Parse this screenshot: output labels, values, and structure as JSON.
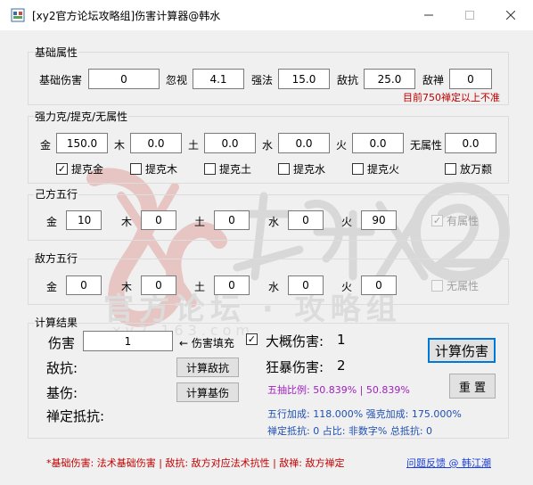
{
  "window": {
    "title": "[xy2官方论坛攻略组]伤害计算器@韩水",
    "icons": [
      "app-icon",
      "minimize-icon",
      "maximize-icon",
      "close-icon"
    ]
  },
  "base": {
    "group_title": "基础属性",
    "base_damage_label": "基础伤害",
    "base_damage": "0",
    "ignore_label": "忽视",
    "ignore": "4.1",
    "strength_label": "强法",
    "strength": "15.0",
    "enemy_resist_label": "敌抗",
    "enemy_resist": "25.0",
    "enemy_zen_label": "敌禅",
    "enemy_zen": "0",
    "note": "目前750禅定以上不准"
  },
  "strong": {
    "group_title": "强力克/提克/无属性",
    "items": [
      {
        "label": "金",
        "value": "150.0",
        "check_label": "提克金",
        "checked": true
      },
      {
        "label": "木",
        "value": "0.0",
        "check_label": "提克木",
        "checked": false
      },
      {
        "label": "土",
        "value": "0.0",
        "check_label": "提克土",
        "checked": false
      },
      {
        "label": "水",
        "value": "0.0",
        "check_label": "提克水",
        "checked": false
      },
      {
        "label": "火",
        "value": "0.0",
        "check_label": "提克火",
        "checked": false
      },
      {
        "label": "无属性",
        "value": "0.0",
        "check_label": "放万颣",
        "checked": false
      }
    ]
  },
  "own": {
    "group_title": "己方五行",
    "items": [
      {
        "label": "金",
        "value": "10"
      },
      {
        "label": "木",
        "value": "0"
      },
      {
        "label": "土",
        "value": "0"
      },
      {
        "label": "水",
        "value": "0"
      },
      {
        "label": "火",
        "value": "90"
      }
    ],
    "attr_label": "有属性",
    "attr_checked": true
  },
  "enemy": {
    "group_title": "敌方五行",
    "items": [
      {
        "label": "金",
        "value": "0"
      },
      {
        "label": "木",
        "value": "0"
      },
      {
        "label": "土",
        "value": "0"
      },
      {
        "label": "水",
        "value": "0"
      },
      {
        "label": "火",
        "value": "0"
      }
    ],
    "attr_label": "无属性",
    "attr_checked": false
  },
  "result": {
    "group_title": "计算结果",
    "damage_label": "伤害",
    "damage_value": "1",
    "fill_hint": "← 伤害填充",
    "enemy_resist_label": "敌抗:",
    "base_damage_label": "基伤:",
    "zen_resist_label": "禅定抵抗:",
    "calc_resist_button": "计算敌抗",
    "calc_base_button": "计算基伤",
    "approx_label": "大概伤害:",
    "approx_value": "1",
    "approx_checked": true,
    "crit_label": "狂暴伤害:",
    "crit_value": "2",
    "ratio_text": "五抽比例: 50.839% | 50.839%",
    "calc_damage_button": "计算伤害",
    "reset_button": "重 置",
    "wuxing_text": "五行加成: 118.000%   强克加成: 175.000%",
    "zen_text": "禅定抵抗: 0   占比: 非数字%   总抵抗: 0"
  },
  "footer": {
    "text": "*基础伤害: 法术基础伤害 | 敌抗: 敌方对应法术抗性 | 敌禅: 敌方禅定",
    "link": "问题反馈 @ 韩江潮"
  },
  "watermark": {
    "main": "新大话西游2",
    "sub": "官方论坛·攻略组",
    "url": "xy2.163.com"
  },
  "colors": {
    "accent": "#0078d7",
    "purple": "#a020c0",
    "blue": "#1f4fb4",
    "red": "#c00000",
    "watermark_red": "#c8322a"
  }
}
